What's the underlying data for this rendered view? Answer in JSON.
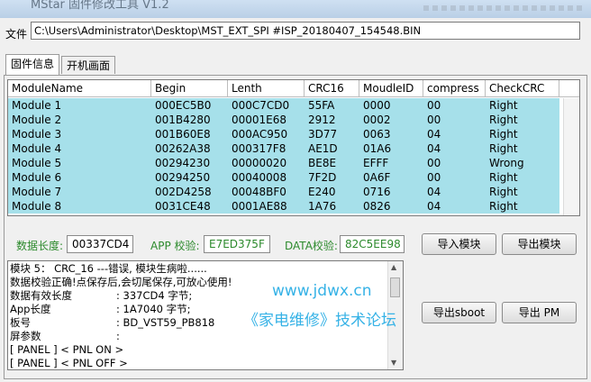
{
  "window": {
    "title": "MStar 固件修改工具 V1.2"
  },
  "file": {
    "label": "文件",
    "path": "C:\\Users\\Administrator\\Desktop\\MST_EXT_SPI #ISP_20180407_154548.BIN"
  },
  "tabs": [
    {
      "label": "固件信息",
      "active": true
    },
    {
      "label": "开机画面",
      "active": false
    }
  ],
  "table": {
    "columns": [
      "ModuleName",
      "Begin",
      "Lenth",
      "CRC16",
      "MoudleID",
      "compress",
      "CheckCRC"
    ],
    "rows": [
      [
        "Module 1",
        "000EC5B0",
        "000C7CD0",
        "55FA",
        "0000",
        "00",
        "Right"
      ],
      [
        "Module 2",
        "001B4280",
        "00001E68",
        "2912",
        "0002",
        "00",
        "Right"
      ],
      [
        "Module 3",
        "001B60E8",
        "000AC950",
        "3D77",
        "0063",
        "04",
        "Right"
      ],
      [
        "Module 4",
        "00262A38",
        "000317F8",
        "AE1D",
        "01A6",
        "04",
        "Right"
      ],
      [
        "Module 5",
        "00294230",
        "00000020",
        "BE8E",
        "EFFF",
        "00",
        "Wrong"
      ],
      [
        "Module 6",
        "00294250",
        "00040008",
        "7F2D",
        "0A6F",
        "00",
        "Right"
      ],
      [
        "Module 7",
        "002D4258",
        "00048BF0",
        "E240",
        "0716",
        "04",
        "Right"
      ],
      [
        "Module 8",
        "0031CE48",
        "0001AE88",
        "1A76",
        "0826",
        "04",
        "Right"
      ]
    ]
  },
  "info": {
    "data_length_label": "数据长度:",
    "data_length_value": "00337CD4",
    "app_check_label": "APP 校验:",
    "app_check_value": "E7ED375F",
    "data_check_label": "DATA校验:",
    "data_check_value": "82C5EE98"
  },
  "buttons": {
    "import_module": "导入模块",
    "export_module": "导出模块",
    "export_sboot": "导出sboot",
    "export_pm": "导出 PM"
  },
  "log": {
    "lines": [
      {
        "k": "模块 5：   CRC_16 ---错误,      模块生病啦......",
        "v": ""
      },
      {
        "k": "数据校验正确!点保存后,会切尾保存,可放心使用!",
        "v": ""
      },
      {
        "k": "数据有效长度",
        "v": ": 337CD4 字节;"
      },
      {
        "k": "App长度",
        "v": ": 1A7040 字节;"
      },
      {
        "k": "板号",
        "v": ": BD_VST59_PB818"
      },
      {
        "k": "屏参数",
        "v": ":"
      },
      {
        "k": "[ PANEL ] < PNL ON >",
        "v": ""
      },
      {
        "k": "[ PANEL ] < PNL OFF >",
        "v": ""
      }
    ]
  },
  "watermark": {
    "line1": "www.jdwx.cn",
    "line2": "《家电维修》技术论坛"
  },
  "colors": {
    "row_highlight": "#a6e0ea",
    "green_text": "#2c8a2c",
    "watermark": "#36b2e6"
  }
}
